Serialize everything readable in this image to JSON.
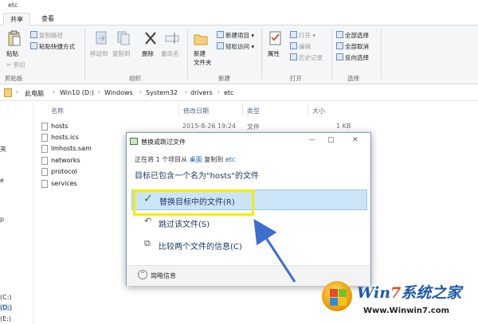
{
  "window": {
    "title": "etc"
  },
  "ribbon_tabs": [
    "共享",
    "查看"
  ],
  "ribbon": {
    "paste": "粘贴",
    "copy_path": "复制路径",
    "paste_shortcut": "粘贴快捷方式",
    "cut": "剪切",
    "clipboard_group": "剪贴板",
    "move_to": "移动到",
    "copy_to": "复制到",
    "delete": "删除",
    "rename": "重命名",
    "organize_group": "组织",
    "new_folder": "新建\n文件夹",
    "new_item": "新建项目",
    "easy_access": "轻松访问",
    "new_group": "新建",
    "properties": "属性",
    "open": "打开",
    "edit": "编辑",
    "history": "历史记录",
    "open_group": "打开",
    "select_all": "全部选择",
    "select_none": "全部取消",
    "invert": "反向选择",
    "select_group": "选择"
  },
  "breadcrumb": [
    "此电脑",
    "Win10 (D:)",
    "Windows",
    "System32",
    "drivers",
    "etc"
  ],
  "nav_fragments": [
    "夹",
    "e",
    "p",
    "(C:)",
    "(D:)",
    "(E:)"
  ],
  "columns": {
    "name": "名称",
    "modified": "修改日期",
    "type": "类型",
    "size": "大小"
  },
  "files": [
    {
      "name": "hosts",
      "modified": "2015-8-26 19:24",
      "type": "文件",
      "size": "1 KB"
    },
    {
      "name": "hosts.ics",
      "modified": "",
      "type": "",
      "size": ""
    },
    {
      "name": "lmhosts.sam",
      "modified": "",
      "type": "",
      "size": ""
    },
    {
      "name": "networks",
      "modified": "",
      "type": "",
      "size": ""
    },
    {
      "name": "protocol",
      "modified": "",
      "type": "",
      "size": ""
    },
    {
      "name": "services",
      "modified": "",
      "type": "",
      "size": ""
    }
  ],
  "dialog": {
    "title": "替换或跳过文件",
    "minimize": "—",
    "maximize": "□",
    "close": "✕",
    "subtitle_prefix": "正在将 1 个项目从",
    "source": "桌面",
    "subtitle_mid": "复制到",
    "dest": "etc",
    "message": "目标已包含一个名为\"hosts\"的文件",
    "option_replace": "替换目标中的文件(R)",
    "option_skip": "跳过该文件(S)",
    "option_compare": "比较两个文件的信息(C)",
    "footer": "简略信息"
  },
  "watermark": {
    "brand_a": "Win",
    "brand_7": "7",
    "brand_b": "系统之家",
    "url": "Www.Winwin7.com"
  },
  "colors": {
    "highlight": "#f3ee00",
    "arrow": "#3d6fd1",
    "selection": "#cce4f7"
  }
}
